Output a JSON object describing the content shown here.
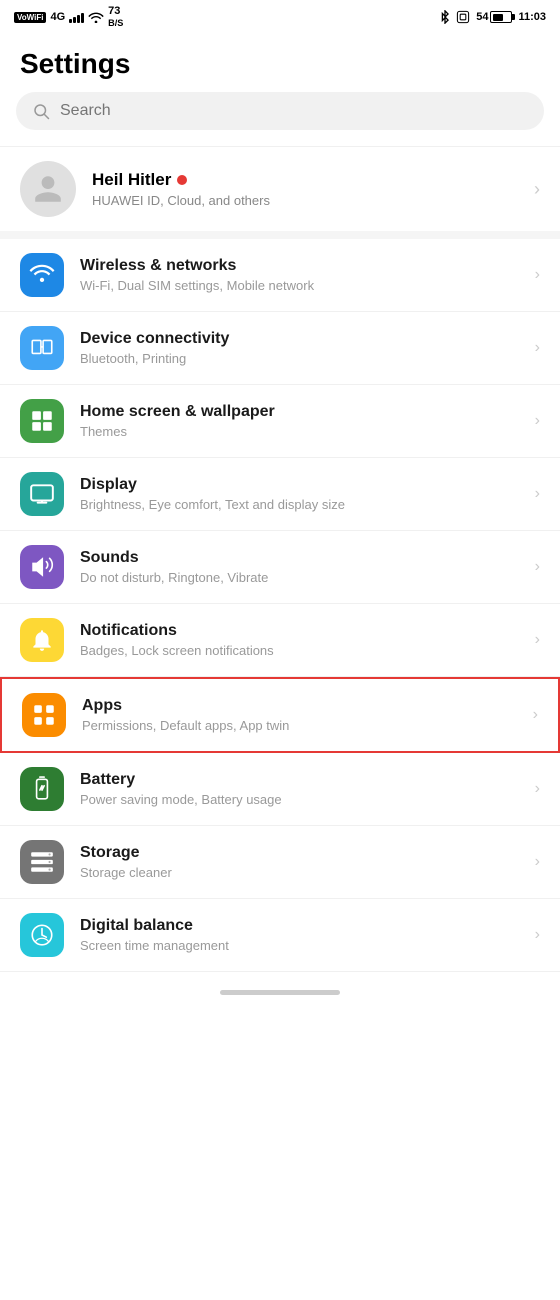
{
  "statusBar": {
    "leftItems": [
      "VoWiFi",
      "4G",
      "73 B/S"
    ],
    "rightItems": [
      "54",
      "11:03"
    ],
    "batteryPercent": "54"
  },
  "pageTitle": "Settings",
  "search": {
    "placeholder": "Search"
  },
  "profile": {
    "name": "Heil Hitler",
    "subtitle": "HUAWEI ID, Cloud, and others"
  },
  "settingsItems": [
    {
      "id": "wireless",
      "title": "Wireless & networks",
      "subtitle": "Wi-Fi, Dual SIM settings, Mobile network",
      "iconColor": "bg-blue",
      "iconType": "wifi"
    },
    {
      "id": "device-connectivity",
      "title": "Device connectivity",
      "subtitle": "Bluetooth, Printing",
      "iconColor": "bg-blue2",
      "iconType": "device-connectivity"
    },
    {
      "id": "home-screen",
      "title": "Home screen & wallpaper",
      "subtitle": "Themes",
      "iconColor": "bg-green",
      "iconType": "home-screen"
    },
    {
      "id": "display",
      "title": "Display",
      "subtitle": "Brightness, Eye comfort, Text and display size",
      "iconColor": "bg-teal",
      "iconType": "display"
    },
    {
      "id": "sounds",
      "title": "Sounds",
      "subtitle": "Do not disturb, Ringtone, Vibrate",
      "iconColor": "bg-purple",
      "iconType": "sounds"
    },
    {
      "id": "notifications",
      "title": "Notifications",
      "subtitle": "Badges, Lock screen notifications",
      "iconColor": "bg-yellow",
      "iconType": "notifications"
    },
    {
      "id": "apps",
      "title": "Apps",
      "subtitle": "Permissions, Default apps, App twin",
      "iconColor": "bg-orange",
      "iconType": "apps",
      "highlighted": true
    },
    {
      "id": "battery",
      "title": "Battery",
      "subtitle": "Power saving mode, Battery usage",
      "iconColor": "bg-green2",
      "iconType": "battery"
    },
    {
      "id": "storage",
      "title": "Storage",
      "subtitle": "Storage cleaner",
      "iconColor": "bg-gray",
      "iconType": "storage"
    },
    {
      "id": "digital-balance",
      "title": "Digital balance",
      "subtitle": "Screen time management",
      "iconColor": "bg-teal2",
      "iconType": "digital-balance"
    }
  ]
}
